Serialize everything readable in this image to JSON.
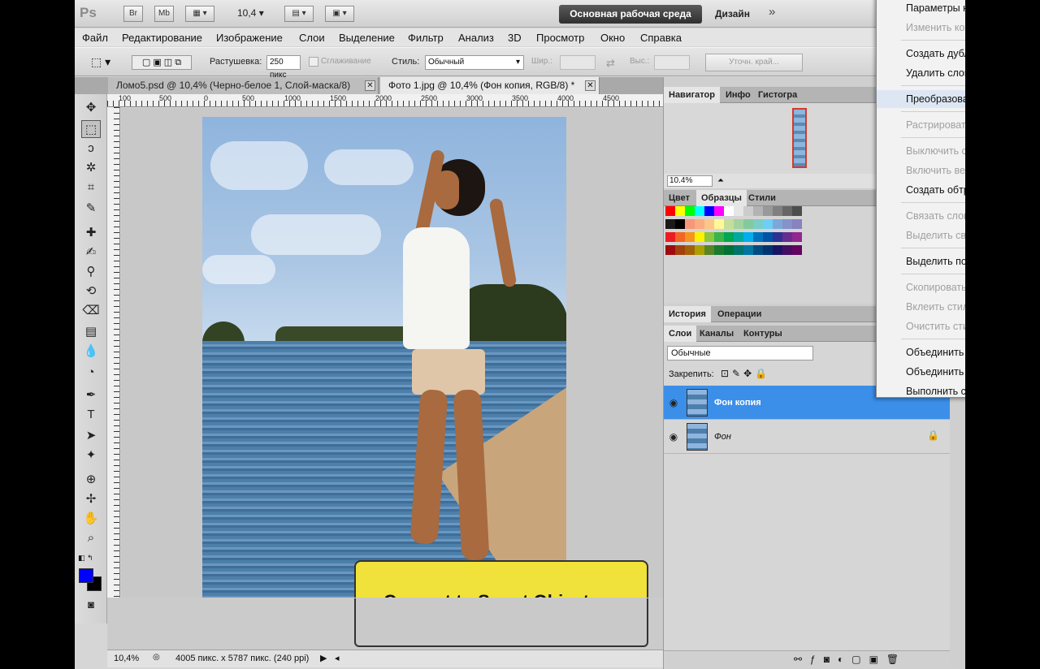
{
  "appbar": {
    "logo": "Ps",
    "br": "Br",
    "mb": "Mb",
    "zoom": "10,4",
    "workspace": "Основная рабочая среда",
    "design": "Дизайн",
    "more": "»"
  },
  "menu": [
    "Файл",
    "Редактирование",
    "Изображение",
    "Слои",
    "Выделение",
    "Фильтр",
    "Анализ",
    "3D",
    "Просмотр",
    "Окно",
    "Справка"
  ],
  "options": {
    "feather_label": "Растушевка:",
    "feather_value": "250 пикс",
    "antialias": "Сглаживание",
    "style_label": "Стиль:",
    "style_value": "Обычный",
    "width_label": "Шир.:",
    "height_label": "Выс.:",
    "refine": "Уточн. край..."
  },
  "tabs": [
    {
      "label": "Ломо5.psd @ 10,4% (Черно-белое 1, Слой-маска/8)"
    },
    {
      "label": "Фото 1.jpg @ 10,4% (Фон копия, RGB/8) *"
    }
  ],
  "ruler": [
    "100",
    "500",
    "0",
    "500",
    "1000",
    "1500",
    "2000",
    "2500",
    "3000",
    "3500",
    "4000",
    "4500"
  ],
  "callout": {
    "text": "Convert to Smart Object"
  },
  "status": {
    "zoom": "10,4%",
    "info": "4005 пикс. x 5787 пикс. (240 ppi)"
  },
  "panels": {
    "nav_tabs": [
      "Навигатор",
      "Инфо",
      "Гистогра"
    ],
    "nav_zoom": "10.4%",
    "color_tabs": [
      "Цвет",
      "Образцы",
      "Стили"
    ],
    "history_tabs": [
      "История",
      "Операции"
    ],
    "layer_tabs": [
      "Слои",
      "Каналы",
      "Контуры"
    ],
    "blend_mode": "Обычные",
    "lock_label": "Закрепить:",
    "layers": [
      {
        "name": "Фон копия"
      },
      {
        "name": "Фон"
      }
    ]
  },
  "context_menu": {
    "items": [
      {
        "label": "Параметры наложения...",
        "enabled": true
      },
      {
        "label": "Изменить корректировку...",
        "enabled": false
      },
      {
        "label": "Создать дубликат слоя...",
        "enabled": true
      },
      {
        "label": "Удалить слой",
        "enabled": true
      },
      {
        "label": "Преобразовать в смарт-объект",
        "enabled": true
      },
      {
        "label": "Растрировать слой",
        "enabled": false
      },
      {
        "label": "Выключить слой-маску",
        "enabled": false
      },
      {
        "label": "Включить векторную маску",
        "enabled": false
      },
      {
        "label": "Создать обтравочную маску",
        "enabled": true
      },
      {
        "label": "Связать слои",
        "enabled": false
      },
      {
        "label": "Выделить связанные слои",
        "enabled": false
      },
      {
        "label": "Выделить похожие слои",
        "enabled": true
      },
      {
        "label": "Скопировать стиль слоя",
        "enabled": false
      },
      {
        "label": "Вклеить стиль слоя",
        "enabled": false
      },
      {
        "label": "Очистить стиль слоя",
        "enabled": false
      },
      {
        "label": "Объединить с предыдущим",
        "enabled": true
      },
      {
        "label": "Объединить видимые",
        "enabled": true
      },
      {
        "label": "Выполнить сведение",
        "enabled": true
      }
    ]
  },
  "colors": {
    "foreground": "#0000ff",
    "background": "#000000",
    "selected_layer": "#3b8fe8",
    "callout": "#f0e23a"
  }
}
